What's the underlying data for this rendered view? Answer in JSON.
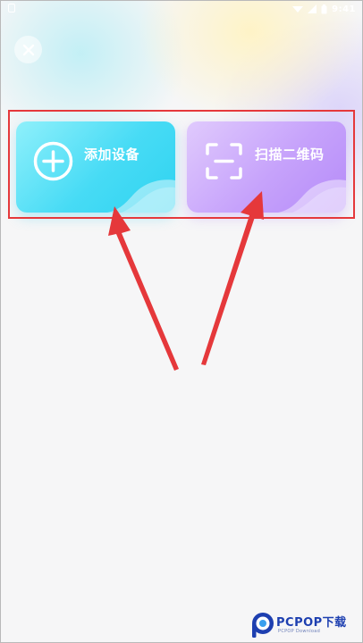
{
  "status_bar": {
    "time": "9:41",
    "icons": [
      "signal-icon",
      "wifi-icon",
      "battery-icon"
    ]
  },
  "close_button": {
    "icon": "close-icon"
  },
  "actions": {
    "add_device": {
      "label": "添加设备",
      "icon": "plus-circle-icon",
      "color_start": "#8ff0fb",
      "color_end": "#2fd3f0"
    },
    "scan_qr": {
      "label": "扫描二维码",
      "icon": "scan-frame-icon",
      "color_start": "#e0cafd",
      "color_end": "#b58bf8"
    }
  },
  "annotation": {
    "highlight_color": "#e5383b",
    "arrow_color": "#e5383b"
  },
  "watermark": {
    "brand": "PCPOP下载",
    "subtitle": "PCPOP Download"
  }
}
